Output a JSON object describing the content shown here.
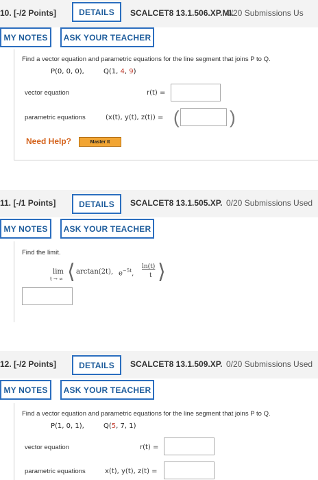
{
  "questions": [
    {
      "number": "10. [-/2 Points]",
      "details_label": "DETAILS",
      "code": "SCALCET8 13.1.506.XP.MI.",
      "submissions": "0/20 Submissions Us",
      "my_notes_label": "MY NOTES",
      "ask_label": "ASK YOUR TEACHER",
      "prompt": "Find a vector equation and parametric equations for the line segment that joins P to Q.",
      "p_point": "P(0, 0, 0),",
      "q_prefix": "Q(1, ",
      "q_red1": "4",
      "q_sep": ", ",
      "q_red2": "9",
      "q_suffix": ")",
      "vector_label": "vector equation",
      "r_label": "r(t)  =",
      "parametric_label": "parametric equations",
      "param_expr": "(x(t), y(t), z(t))  =",
      "need_help": "Need Help?",
      "master_it": "Master It"
    },
    {
      "number": "11. [-/1 Points]",
      "details_label": "DETAILS",
      "code": "SCALCET8 13.1.505.XP.",
      "submissions": "0/20 Submissions Used",
      "my_notes_label": "MY NOTES",
      "ask_label": "ASK YOUR TEACHER",
      "prompt": "Find the limit.",
      "lim": "lim",
      "lim_sub": "t → ∞",
      "arctan": "arctan(2t),",
      "exp_base": "e",
      "exp_power": "−5t",
      "frac_num": "ln(t)",
      "frac_den": "t"
    },
    {
      "number": "12. [-/2 Points]",
      "details_label": "DETAILS",
      "code": "SCALCET8 13.1.509.XP.",
      "submissions": "0/20 Submissions Used",
      "my_notes_label": "MY NOTES",
      "ask_label": "ASK YOUR TEACHER",
      "prompt": "Find a vector equation and parametric equations for the line segment that joins P to Q.",
      "p_point": "P(1, 0, 1),",
      "q_prefix": "Q(",
      "q_red1": "5",
      "q_sep": ", 7, 1)",
      "vector_label": "vector equation",
      "r_label": "r(t)  =",
      "parametric_label": "parametric equations",
      "param_expr": "x(t), y(t), z(t)  ="
    }
  ],
  "colors": {
    "accent": "#2b6ebf",
    "red": "#c0392b",
    "help": "#d4621b",
    "master": "#f2a533"
  }
}
